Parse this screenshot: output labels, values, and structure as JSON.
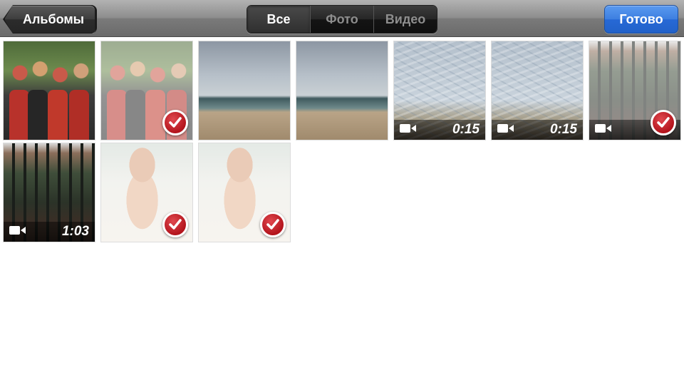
{
  "navbar": {
    "back_label": "Альбомы",
    "segments": [
      {
        "label": "Все",
        "selected": true
      },
      {
        "label": "Фото",
        "selected": false
      },
      {
        "label": "Видео",
        "selected": false
      }
    ],
    "done_label": "Готово"
  },
  "grid": {
    "items": [
      {
        "kind": "photo",
        "scene": "group-people",
        "selected": false
      },
      {
        "kind": "photo",
        "scene": "group-people",
        "selected": true
      },
      {
        "kind": "photo",
        "scene": "cloudy-beach",
        "selected": false
      },
      {
        "kind": "photo",
        "scene": "cloudy-beach",
        "selected": false
      },
      {
        "kind": "video",
        "scene": "waves",
        "duration": "0:15",
        "selected": false
      },
      {
        "kind": "video",
        "scene": "waves",
        "duration": "0:15",
        "selected": false
      },
      {
        "kind": "video",
        "scene": "balcony",
        "selected": true
      },
      {
        "kind": "video",
        "scene": "balcony",
        "duration": "1:03",
        "selected": false
      },
      {
        "kind": "photo",
        "scene": "girl-beach",
        "selected": true
      },
      {
        "kind": "photo",
        "scene": "girl-beach",
        "selected": true
      }
    ]
  },
  "colors": {
    "done_button": "#2769d6",
    "checkmark": "#c1171f",
    "navbar": "#8e8e8e"
  },
  "icons": {
    "selected_mark": "checkmark-icon",
    "video": "video-camera-icon",
    "back": "back-arrow-icon"
  }
}
